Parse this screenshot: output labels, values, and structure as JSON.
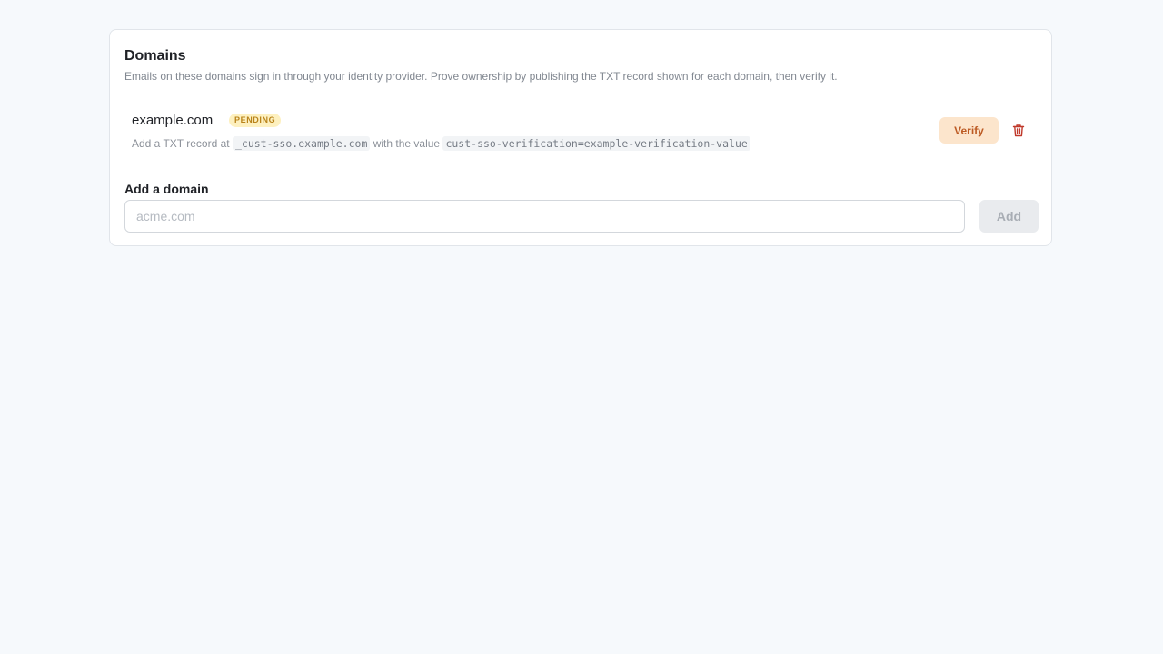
{
  "section": {
    "title": "Domains",
    "description": "Emails on these domains sign in through your identity provider. Prove ownership by publishing the TXT record shown for each domain, then verify it."
  },
  "domains": [
    {
      "name": "example.com",
      "status": "PENDING",
      "instruction_prefix": "Add a TXT record at",
      "record_host": "_cust-sso.example.com",
      "instruction_middle": "with the value",
      "record_value": "cust-sso-verification=example-verification-value",
      "verify_label": "Verify",
      "delete_icon": "trash-icon"
    }
  ],
  "add_domain": {
    "label": "Add a domain",
    "placeholder": "acme.com",
    "value": "",
    "button_label": "Add"
  },
  "colors": {
    "background": "#f6f9fc",
    "pending_badge_bg": "#fdf0bf",
    "pending_badge_text": "#b9831a",
    "verify_bg": "#fce5cc",
    "verify_text": "#bd5b24",
    "delete_icon": "#c0392b",
    "add_button_disabled_bg": "#e9ebee"
  }
}
